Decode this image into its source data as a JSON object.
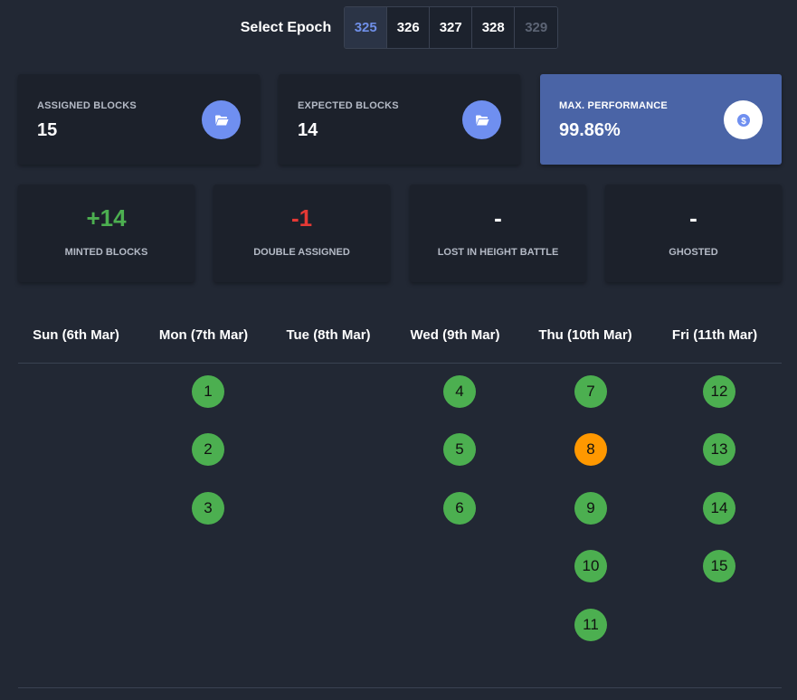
{
  "epoch": {
    "label": "Select Epoch",
    "options": [
      "325",
      "326",
      "327",
      "328",
      "329"
    ],
    "selected": "325"
  },
  "cards": {
    "assigned": {
      "label": "ASSIGNED BLOCKS",
      "value": "15",
      "icon": "folder-open-icon"
    },
    "expected": {
      "label": "EXPECTED BLOCKS",
      "value": "14",
      "icon": "folder-open-icon"
    },
    "performance": {
      "label": "MAX. PERFORMANCE",
      "value": "99.86%",
      "icon": "dollar-coin-icon"
    }
  },
  "stats": {
    "minted": {
      "value": "+14",
      "label": "MINTED BLOCKS"
    },
    "double": {
      "value": "-1",
      "label": "DOUBLE ASSIGNED"
    },
    "lost": {
      "value": "-",
      "label": "LOST IN HEIGHT BATTLE"
    },
    "ghosted": {
      "value": "-",
      "label": "GHOSTED"
    }
  },
  "calendar": {
    "days": [
      "Sun (6th Mar)",
      "Mon (7th Mar)",
      "Tue (8th Mar)",
      "Wed (9th Mar)",
      "Thu (10th Mar)",
      "Fri (11th Mar)"
    ],
    "blocks": {
      "sun": [],
      "mon": [
        "1",
        "2",
        "3"
      ],
      "tue": [],
      "wed": [
        "4",
        "5",
        "6"
      ],
      "thu": [
        "7",
        "8",
        "9",
        "10",
        "11"
      ],
      "fri": [
        "12",
        "13",
        "14",
        "15"
      ]
    },
    "double_assigned_block": "8"
  },
  "colors": {
    "accent": "#6f8ff0",
    "minted": "#4caf50",
    "double_assigned": "#ff9800",
    "negative": "#e53935",
    "background": "#222834"
  }
}
